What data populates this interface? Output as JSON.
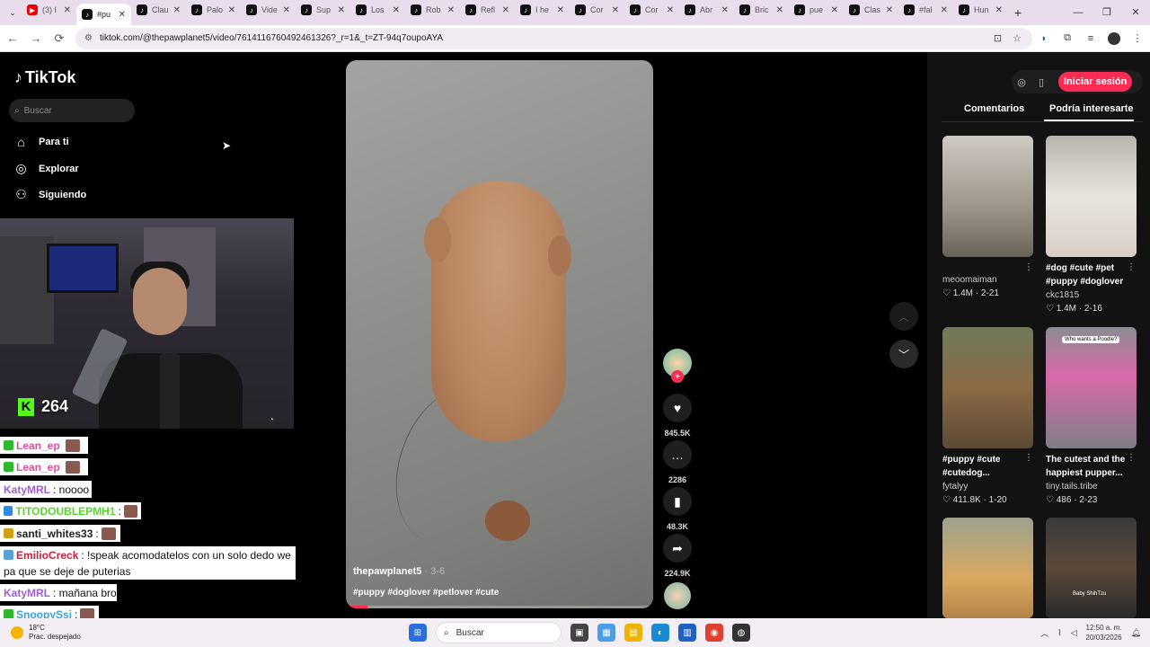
{
  "browser": {
    "tabs": [
      {
        "label": "(3) I",
        "icon": "youtube-icon",
        "active": false
      },
      {
        "label": "#pu",
        "icon": "tiktok-icon",
        "active": true
      },
      {
        "label": "Clau",
        "icon": "tiktok-icon",
        "active": false
      },
      {
        "label": "Palo",
        "icon": "tiktok-icon",
        "active": false
      },
      {
        "label": "Vide",
        "icon": "tiktok-icon",
        "active": false
      },
      {
        "label": "Sup",
        "icon": "tiktok-icon",
        "active": false
      },
      {
        "label": "Los",
        "icon": "tiktok-icon",
        "active": false
      },
      {
        "label": "Rob",
        "icon": "tiktok-icon",
        "active": false
      },
      {
        "label": "Refl",
        "icon": "tiktok-icon",
        "active": false
      },
      {
        "label": "I he",
        "icon": "tiktok-icon",
        "active": false
      },
      {
        "label": "Cor",
        "icon": "tiktok-icon",
        "active": false
      },
      {
        "label": "Cor",
        "icon": "tiktok-icon",
        "active": false
      },
      {
        "label": "Abr",
        "icon": "tiktok-icon",
        "active": false
      },
      {
        "label": "Bric",
        "icon": "tiktok-icon",
        "active": false
      },
      {
        "label": "pue",
        "icon": "tiktok-icon",
        "active": false
      },
      {
        "label": "Clas",
        "icon": "tiktok-icon",
        "active": false
      },
      {
        "label": "#fal",
        "icon": "tiktok-icon",
        "active": false
      },
      {
        "label": "Hun",
        "icon": "tiktok-icon",
        "active": false
      }
    ],
    "url": "tiktok.com/@thepawplanet5/video/7614116760492461326?_r=1&_t=ZT-94q7oupoAYA"
  },
  "tiktok": {
    "logo": "TikTok",
    "search_placeholder": "Buscar",
    "nav": [
      {
        "label": "Para ti",
        "icon": "home-icon"
      },
      {
        "label": "Explorar",
        "icon": "compass-icon"
      },
      {
        "label": "Siguiendo",
        "icon": "following-icon"
      }
    ],
    "video": {
      "username": "thepawplanet5",
      "date": "· 3-6",
      "hashtags": "#puppy #doglover #petlover #cute",
      "progress": 0.07
    },
    "actions": {
      "likes": "845.5K",
      "comments": "2286",
      "saves": "48.3K",
      "shares": "224.9K"
    },
    "right_panel": {
      "login_label": "Iniciar sesión",
      "tab_comments": "Comentarios",
      "tab_suggested": "Podría interesarte",
      "cards": [
        {
          "title": "",
          "user": "meoomaiman",
          "stats": "♡ 1.4M · 2-21"
        },
        {
          "title": "#dog #cute #pet #puppy #doglover",
          "user": "ckc1815",
          "stats": "♡ 1.4M · 2-16"
        },
        {
          "title": "#puppy #cute #cutedog...",
          "user": "fytalyy",
          "stats": "♡ 411.8K · 1-20"
        },
        {
          "title": "The cutest and the happiest pupper...",
          "user": "tiny.tails.tribe",
          "stats": "♡ 486 · 2-23"
        },
        {
          "title": "",
          "user": "",
          "stats": ""
        },
        {
          "title": "",
          "user": "",
          "stats": ""
        }
      ],
      "thumb4_caption": "Who wants a Poodle?",
      "thumb6_caption": "Baby ShihTzu"
    }
  },
  "overlay": {
    "kick_count": "264",
    "chat": [
      {
        "user": "Lean_ep",
        "color": "#e0529c",
        "message": "",
        "badge": "#2eb82e"
      },
      {
        "user": "Lean_ep",
        "color": "#e0529c",
        "message": "",
        "badge": "#2eb82e"
      },
      {
        "user": "KatyMRL",
        "color": "#a05cd6",
        "message": ": noooo",
        "badge": ""
      },
      {
        "user": "TITODOUBLEPMH1",
        "color": "#5bd62e",
        "message": ":",
        "badge": "#2b8ae2"
      },
      {
        "user": "santi_whites33",
        "color": "#222222",
        "message": ":",
        "badge": "#d4a017"
      },
      {
        "user": "EmilioCreck",
        "color": "#d0203c",
        "message": ": !speak acomodatelos con un solo dedo we",
        "badge": "#5aa0d8"
      },
      {
        "user": "",
        "color": "#111111",
        "message": "pa que se deje de puterias",
        "badge": ""
      },
      {
        "user": "KatyMRL",
        "color": "#a05cd6",
        "message": ": mañana bro",
        "badge": ""
      },
      {
        "user": "SnoopySsj",
        "color": "#3aa0e0",
        "message": ":",
        "badge": "#2eb82e"
      }
    ]
  },
  "taskbar": {
    "temp": "18°C",
    "condition": "Prac. despejado",
    "search_placeholder": "Buscar",
    "time": "12:50 a. m.",
    "date": "20/03/2026"
  },
  "colors": {
    "accent": "#fe2c55",
    "kick": "#53fc18"
  }
}
